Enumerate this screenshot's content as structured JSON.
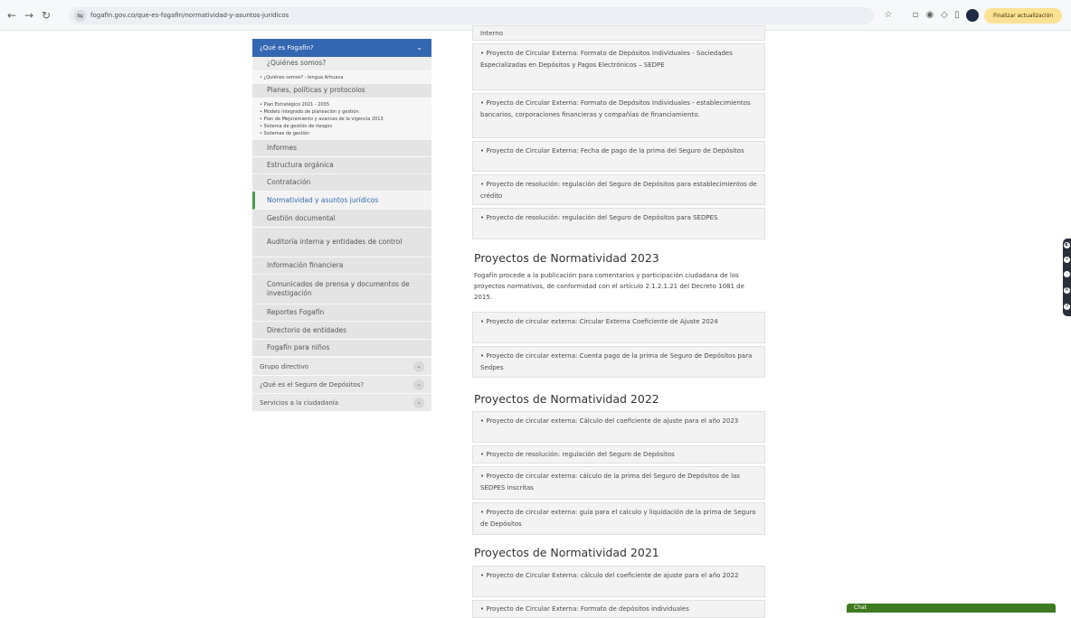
{
  "browser": {
    "url": "fogafin.gov.co/que-es-fogafin/normatividad-y-asuntos-juridicos",
    "update_button": "Finalizar actualización"
  },
  "sidebar": {
    "header": "¿Qué es Fogafin?",
    "quienes": "¿Quiénes somos?",
    "quienes_bullets": [
      "¿Quiénes somos? - lengua Arhuaca"
    ],
    "planes": "Planes, políticas y protocolos",
    "planes_bullets": [
      "Plan Estratégico 2021 - 2035",
      "Modelo integrado de planeación y gestión",
      "Plan de Mejoramiento y avances de la vigencia 2013",
      "Sistema de gestión de riesgos",
      "Sistemas de gestión"
    ],
    "items": [
      "Informes",
      "Estructura orgánica",
      "Contratación",
      "Normatividad y asuntos jurídicos",
      "Gestión documental",
      "Auditoría interna y entidades de control",
      "Información financiera",
      "Comunicados de prensa y documentos de investigación",
      "Reportes Fogafín",
      "Directorio de entidades",
      "Fogafín para niños"
    ],
    "collapsed": [
      "Grupo directivo",
      "¿Qué es el Seguro de Depósitos?",
      "Servicios a la ciudadanía"
    ]
  },
  "main": {
    "top_cards": [
      "Interno",
      "• Proyecto de Circular Externa: Formato de Depósitos Individuales - Sociedades Especializadas en Depósitos y Pagos Electrónicos – SEDPE",
      "• Proyecto de Circular Externa: Formato de Depósitos Individuales - establecimientos bancarios, corporaciones financieras y compañías de financiamiento.",
      "• Proyecto de Circular Externa: Fecha de pago de la prima del Seguro de Depósitos",
      "• Proyecto de resolución: regulación del Seguro de Depósitos para establecimientos de crédito",
      "• Proyecto de resolución: regulación del Seguro de Depósitos para SEDPES"
    ],
    "sec2023": {
      "title": "Proyectos de Normatividad 2023",
      "desc": "Fogafín procede a la publicación para comentarios y participación ciudadana de los proyectos normativos, de conformidad con el artículo 2.1.2.1.21 del Decreto 1081 de 2015.",
      "cards": [
        "• Proyecto de circular externa: Circular Externa Coeficiente de Ajuste 2024",
        "• Proyecto de circular externa: Cuenta pago de la prima de Seguro de Depósitos para Sedpes"
      ]
    },
    "sec2022": {
      "title": "Proyectos de Normatividad 2022",
      "cards": [
        "• Proyecto de circular externa: Cálculo del coeficiente de ajuste para el año 2023",
        "• Proyecto de resolución: regulación del Seguro de Depósitos",
        "• Proyecto de circular externa: cálculo de la prima del Seguro de Depósitos de las SEDPES inscritas",
        "• Proyecto de circular externa: guía para el calculo y liquidación de la prima de Seguro de Depósitos"
      ]
    },
    "sec2021": {
      "title": "Proyectos de Normatividad 2021",
      "cards": [
        "• Proyecto de Circular Externa: cálculo del coeficiente de ajuste para el año 2022",
        "• Proyecto de Circular Externa: Formato de depósitos individuales"
      ]
    }
  },
  "chat": {
    "label": "Chat"
  },
  "icons": {
    "back": "arrow-left-icon",
    "forward": "arrow-right-icon",
    "reload": "reload-icon",
    "info": "site-info-icon",
    "star": "star-icon",
    "extensions": "puzzle-icon",
    "profile": "profile-icon",
    "a11y": [
      "contrast-icon",
      "zoom-in-icon",
      "zoom-out-icon",
      "text-size-icon",
      "reset-icon"
    ]
  },
  "colors": {
    "header_blue": "#3467b1",
    "active_green": "#4a9b4a",
    "chat_green": "#3e7a1f",
    "update_yellow": "#fde293"
  }
}
